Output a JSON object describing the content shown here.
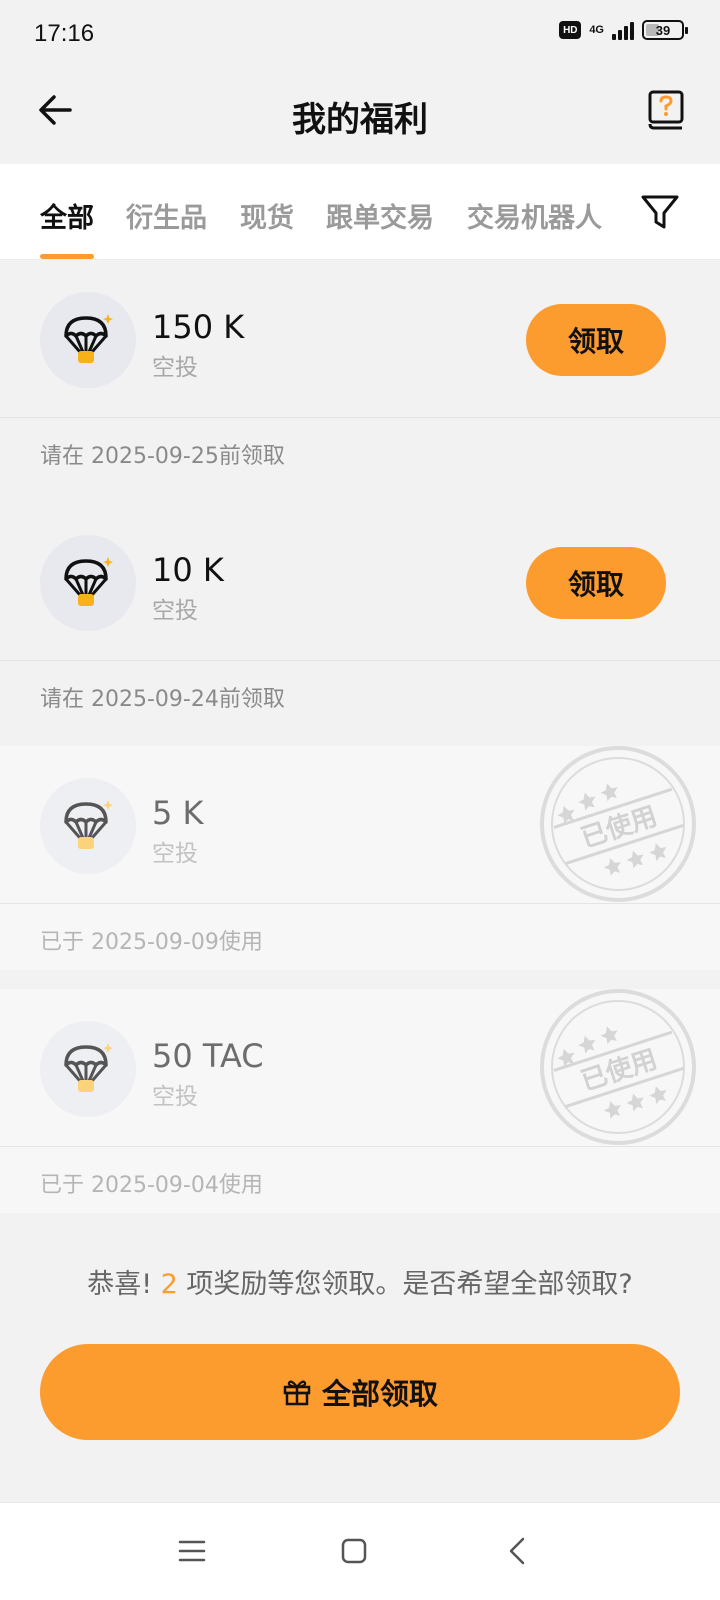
{
  "status_bar": {
    "time": "17:16",
    "network": "4G",
    "battery": "39",
    "battery_level": 0.39
  },
  "header": {
    "title": "我的福利",
    "back_icon": "arrow-left-icon",
    "help_icon": "help-book-icon"
  },
  "tabs": [
    {
      "label": "全部",
      "active": true
    },
    {
      "label": "衍生品",
      "active": false
    },
    {
      "label": "现货",
      "active": false
    },
    {
      "label": "跟单交易",
      "active": false
    },
    {
      "label": "交易机器人",
      "active": false
    }
  ],
  "filter_icon": "filter-icon",
  "rewards": [
    {
      "amount": "150 K",
      "type": "空投",
      "button": "领取",
      "note": "请在 2025-09-25前领取",
      "used": false
    },
    {
      "amount": "10 K",
      "type": "空投",
      "button": "领取",
      "note": "请在 2025-09-24前领取",
      "used": false
    },
    {
      "amount": "5 K",
      "type": "空投",
      "stamp": "已使用",
      "note": "已于 2025-09-09使用",
      "used": true
    },
    {
      "amount": "50 TAC",
      "type": "空投",
      "stamp": "已使用",
      "note": "已于 2025-09-04使用",
      "used": true
    }
  ],
  "footer": {
    "prefix": "恭喜!",
    "count": "2",
    "suffix": "项奖励等您领取。是否希望全部领取?",
    "claim_all_label": "全部领取",
    "gift_icon": "gift-icon"
  },
  "colors": {
    "accent": "#fd9c2e",
    "background": "#f2f2f2"
  }
}
